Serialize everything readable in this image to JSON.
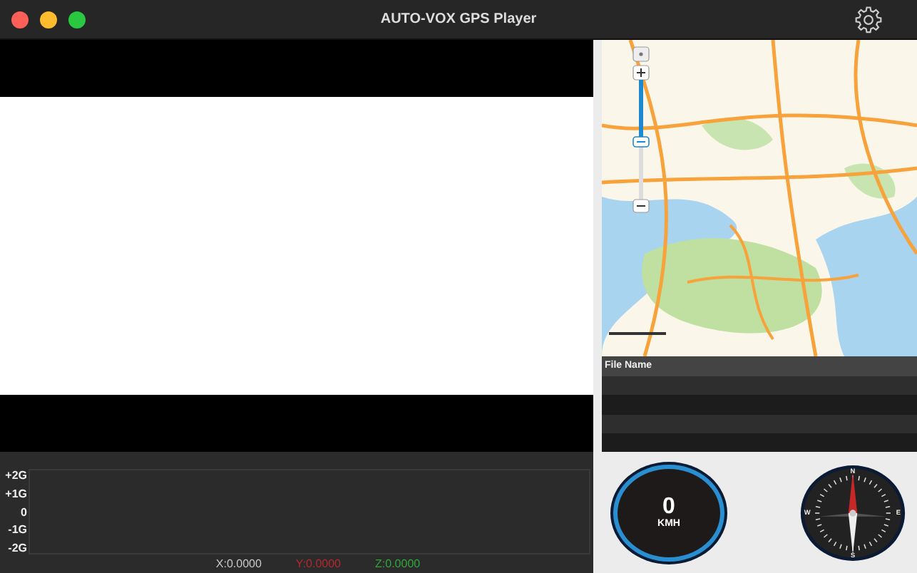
{
  "window": {
    "title": "AUTO-VOX GPS Player"
  },
  "map": {
    "kind": "picture",
    "zoom": {
      "level": 0.5
    }
  },
  "file_table": {
    "columns": [
      "File Name"
    ]
  },
  "accelerometer": {
    "y_ticks": [
      "+2G",
      "+1G",
      "0",
      "-1G",
      "-2G"
    ],
    "readouts": [
      {
        "label": "X:0.0000",
        "color": "#c8c8c8"
      },
      {
        "label": "Y:0.0000",
        "color": "#b5282e"
      },
      {
        "label": "Z:0.0000",
        "color": "#2fa83a"
      }
    ]
  },
  "speedometer": {
    "value": "0",
    "unit": "KMH"
  },
  "compass": {
    "labels": [
      "N",
      "E",
      "S",
      "W"
    ]
  }
}
